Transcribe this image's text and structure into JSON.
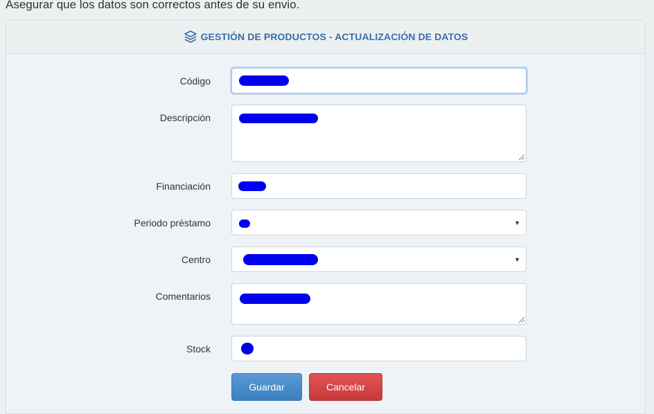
{
  "intro_text": "Asegurar que los datos son correctos antes de su envio.",
  "panel": {
    "title": "GESTIÓN DE PRODUCTOS - ACTUALIZACIÓN DE DATOS",
    "icon": "layers-icon"
  },
  "form": {
    "codigo_label": "Código",
    "descripcion_label": "Descripción",
    "financiacion_label": "Financiación",
    "periodo_label": "Periodo préstamo",
    "centro_label": "Centro",
    "comentarios_label": "Comentarios",
    "stock_label": "Stock",
    "redacted_note": "field values obscured by blue redaction marks"
  },
  "buttons": {
    "save": "Guardar",
    "cancel": "Cancelar"
  },
  "colors": {
    "title": "#3a6ea5",
    "primary": "#4a8cc9",
    "danger": "#d84848",
    "redaction": "#0000ee"
  }
}
